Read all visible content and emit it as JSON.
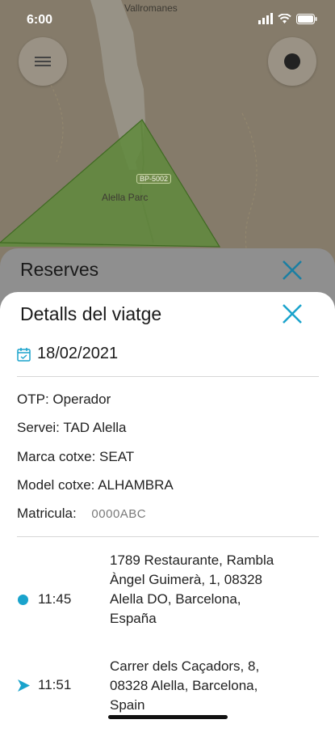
{
  "status_bar": {
    "time": "6:00"
  },
  "map": {
    "labels": {
      "town_top": "Vallromanes",
      "park": "Alella Parc",
      "road": "BP-5002"
    }
  },
  "back_sheet": {
    "title": "Reserves"
  },
  "sheet": {
    "title": "Detalls del viatge",
    "date": "18/02/2021",
    "details": [
      {
        "key": "OTP:",
        "value": "Operador"
      },
      {
        "key": "Servei:",
        "value": "TAD Alella"
      },
      {
        "key": "Marca cotxe:",
        "value": "SEAT"
      },
      {
        "key": "Model cotxe:",
        "value": "ALHAMBRA"
      },
      {
        "key": "Matricula:",
        "value": "0000ABC"
      }
    ],
    "stops": [
      {
        "time": "11:45",
        "address": "1789 Restaurante, Rambla Àngel Guimerà, 1, 08328 Alella DO, Barcelona, España",
        "icon": "origin-dot-icon"
      },
      {
        "time": "11:51",
        "address": "Carrer dels Caçadors, 8, 08328 Alella, Barcelona, Spain",
        "icon": "navigation-arrow-icon"
      }
    ]
  },
  "colors": {
    "accent": "#1aa3cc",
    "map_zone": "#5f8a3c"
  }
}
